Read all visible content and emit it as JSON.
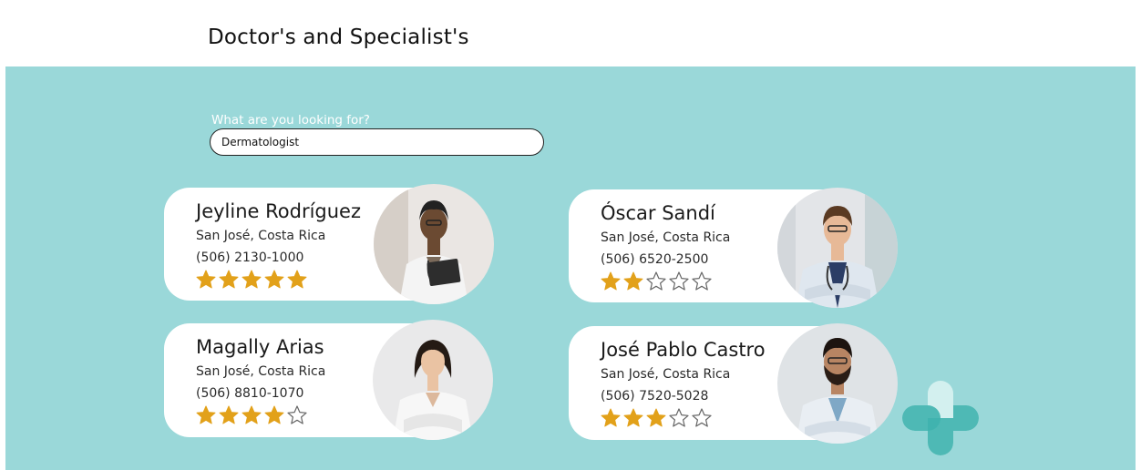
{
  "page": {
    "title": "Doctor's and Specialist's"
  },
  "search": {
    "label": "What are you looking for?",
    "value": "Dermatologist"
  },
  "colors": {
    "panel": "#9ad8d9",
    "star_filled": "#e2a11a",
    "star_empty": "#666666",
    "logo_dark": "#3fb3ae",
    "logo_light": "#d3f0ef"
  },
  "doctors": [
    {
      "name": "Jeyline Rodríguez",
      "location": "San José, Costa Rica",
      "phone": "(506) 2130-1000",
      "rating": 5,
      "rating_max": 5
    },
    {
      "name": "Óscar Sandí",
      "location": "San José, Costa Rica",
      "phone": "(506) 6520-2500",
      "rating": 2,
      "rating_max": 5
    },
    {
      "name": "Magally Arias",
      "location": "San José, Costa Rica",
      "phone": "(506) 8810-1070",
      "rating": 4,
      "rating_max": 5
    },
    {
      "name": "José Pablo Castro",
      "location": "San José, Costa Rica",
      "phone": "(506) 7520-5028",
      "rating": 3,
      "rating_max": 5
    }
  ]
}
